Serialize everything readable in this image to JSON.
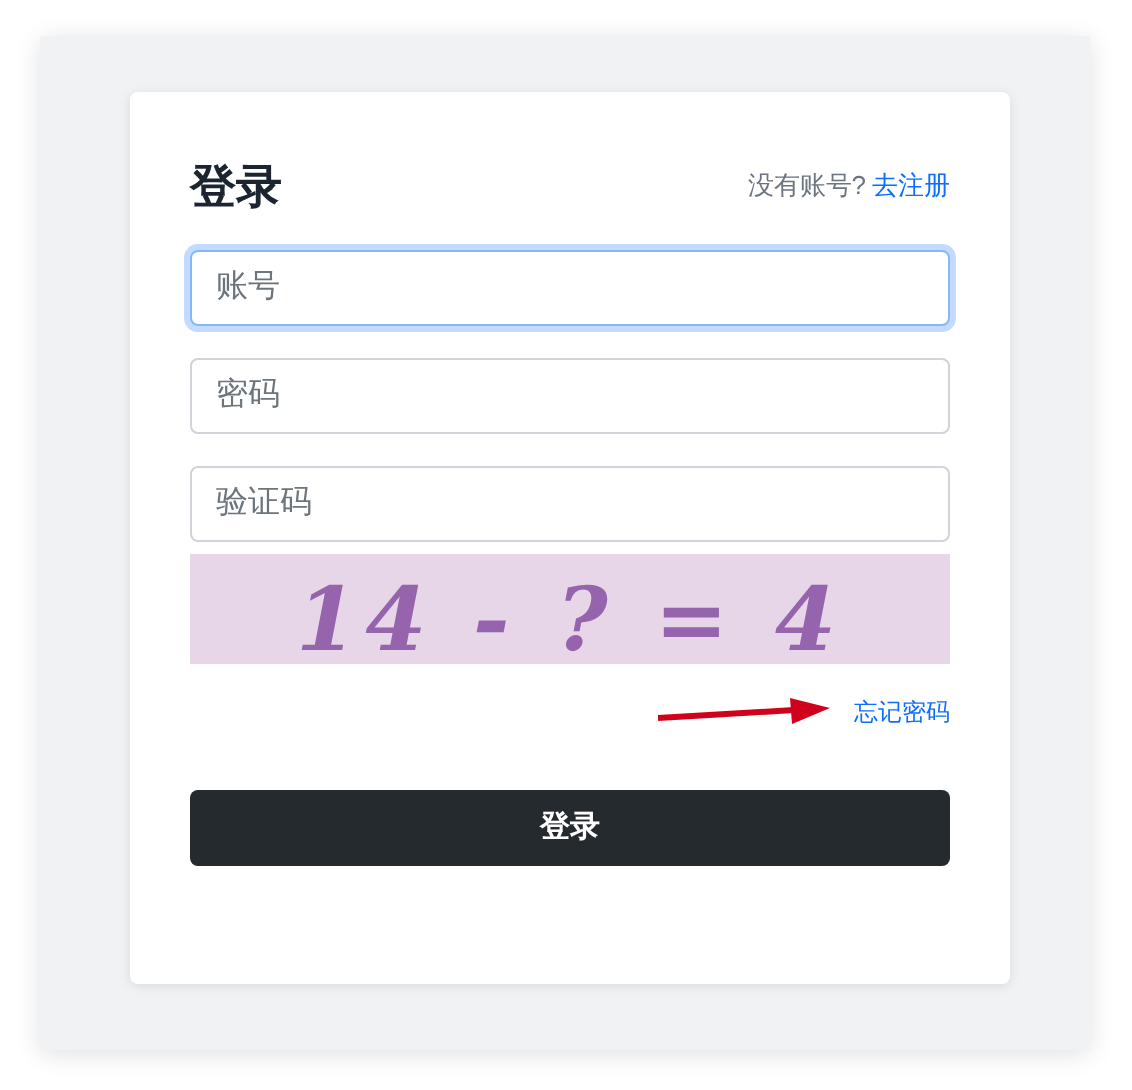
{
  "title": "登录",
  "register_prompt": {
    "text": "没有账号?",
    "link": "去注册"
  },
  "fields": [
    {
      "placeholder": "账号",
      "focused": true
    },
    {
      "placeholder": "密码",
      "focused": false
    },
    {
      "placeholder": "验证码",
      "focused": false
    }
  ],
  "captcha": {
    "text": "14 - ? = 4"
  },
  "forgot_link": "忘记密码",
  "submit_button": "登录"
}
